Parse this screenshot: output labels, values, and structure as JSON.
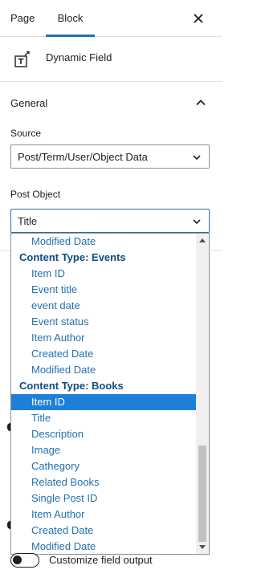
{
  "tabs": {
    "page": "Page",
    "block": "Block"
  },
  "block": {
    "title": "Dynamic Field"
  },
  "panel": {
    "title": "General"
  },
  "source": {
    "label": "Source",
    "value": "Post/Term/User/Object Data"
  },
  "post_object": {
    "label": "Post Object",
    "value": "Title"
  },
  "dropdown": {
    "options": [
      {
        "text": "Modified Date",
        "type": "option"
      },
      {
        "text": "Content Type: Events",
        "type": "group"
      },
      {
        "text": "Item ID",
        "type": "option"
      },
      {
        "text": "Event title",
        "type": "option"
      },
      {
        "text": "event date",
        "type": "option"
      },
      {
        "text": "Event status",
        "type": "option"
      },
      {
        "text": "Item Author",
        "type": "option"
      },
      {
        "text": "Created Date",
        "type": "option"
      },
      {
        "text": "Modified Date",
        "type": "option"
      },
      {
        "text": "Content Type: Books",
        "type": "group"
      },
      {
        "text": "Item ID",
        "type": "option",
        "selected": true
      },
      {
        "text": "Title",
        "type": "option"
      },
      {
        "text": "Description",
        "type": "option"
      },
      {
        "text": "Image",
        "type": "option"
      },
      {
        "text": "Cathegory",
        "type": "option"
      },
      {
        "text": "Related Books",
        "type": "option"
      },
      {
        "text": "Single Post ID",
        "type": "option"
      },
      {
        "text": "Item Author",
        "type": "option"
      },
      {
        "text": "Created Date",
        "type": "option"
      },
      {
        "text": "Modified Date",
        "type": "option"
      }
    ]
  },
  "toggle": {
    "label": "Customize field output",
    "checked": false
  },
  "colors": {
    "accent": "#2271b1",
    "selected_bg": "#1e7fd8",
    "group_text": "#0f4c81"
  },
  "icons": {
    "close": "close-icon",
    "block": "dynamic-field-icon",
    "panel_toggle": "chevron-up-icon",
    "select": "chevron-down-icon"
  }
}
